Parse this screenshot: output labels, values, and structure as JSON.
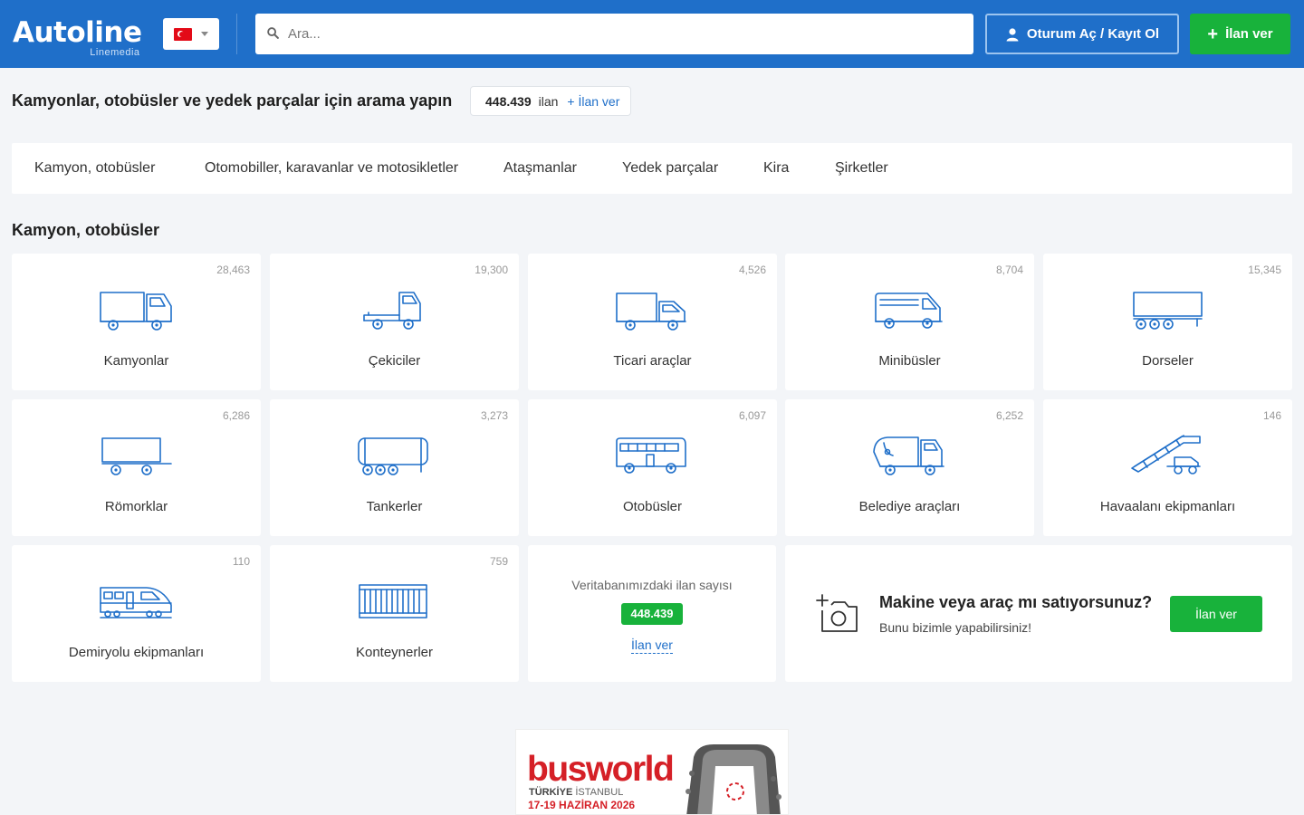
{
  "header": {
    "logo_text": "Autoline",
    "logo_sub": "Linemedia",
    "language_flag": "turkey-flag",
    "search_placeholder": "Ara...",
    "login_label": "Oturum Aç / Kayıt Ol",
    "post_label": "İlan ver",
    "colors": {
      "header_bg": "#1f6fc9",
      "green": "#18b23b"
    }
  },
  "headline": {
    "text": "Kamyonlar, otobüsler ve yedek parçalar için arama yapın",
    "count": "448.439",
    "count_label": "ilan",
    "add_link": "+ İlan ver"
  },
  "nav": {
    "items": [
      "Kamyon, otobüsler",
      "Otomobiller, karavanlar ve motosikletler",
      "Ataşmanlar",
      "Yedek parçalar",
      "Kira",
      "Şirketler"
    ]
  },
  "section_title": "Kamyon, otobüsler",
  "categories": [
    {
      "name": "Kamyonlar",
      "count": "28,463",
      "icon": "truck-icon"
    },
    {
      "name": "Çekiciler",
      "count": "19,300",
      "icon": "tractor-unit-icon"
    },
    {
      "name": "Ticari araçlar",
      "count": "4,526",
      "icon": "commercial-vehicle-icon"
    },
    {
      "name": "Minibüsler",
      "count": "8,704",
      "icon": "minibus-icon"
    },
    {
      "name": "Dorseler",
      "count": "15,345",
      "icon": "semi-trailer-icon"
    },
    {
      "name": "Römorklar",
      "count": "6,286",
      "icon": "trailer-icon"
    },
    {
      "name": "Tankerler",
      "count": "3,273",
      "icon": "tanker-icon"
    },
    {
      "name": "Otobüsler",
      "count": "6,097",
      "icon": "bus-icon"
    },
    {
      "name": "Belediye araçları",
      "count": "6,252",
      "icon": "municipal-vehicle-icon"
    },
    {
      "name": "Havaalanı ekipmanları",
      "count": "146",
      "icon": "airport-stairs-icon"
    },
    {
      "name": "Demiryolu ekipmanları",
      "count": "110",
      "icon": "train-icon"
    },
    {
      "name": "Konteynerler",
      "count": "759",
      "icon": "container-icon"
    }
  ],
  "stats": {
    "label": "Veritabanımızdaki ilan sayısı",
    "value": "448.439",
    "link": "İlan ver"
  },
  "sell": {
    "title": "Makine veya araç mı satıyorsunuz?",
    "subtitle": "Bunu bizimle yapabilirsiniz!",
    "button": "İlan ver",
    "icon": "add-photo-icon"
  },
  "banner": {
    "brand": "busworld",
    "location_bold": "TÜRKİYE",
    "location": "İSTANBUL",
    "dates": "17-19 HAZİRAN 2026"
  }
}
